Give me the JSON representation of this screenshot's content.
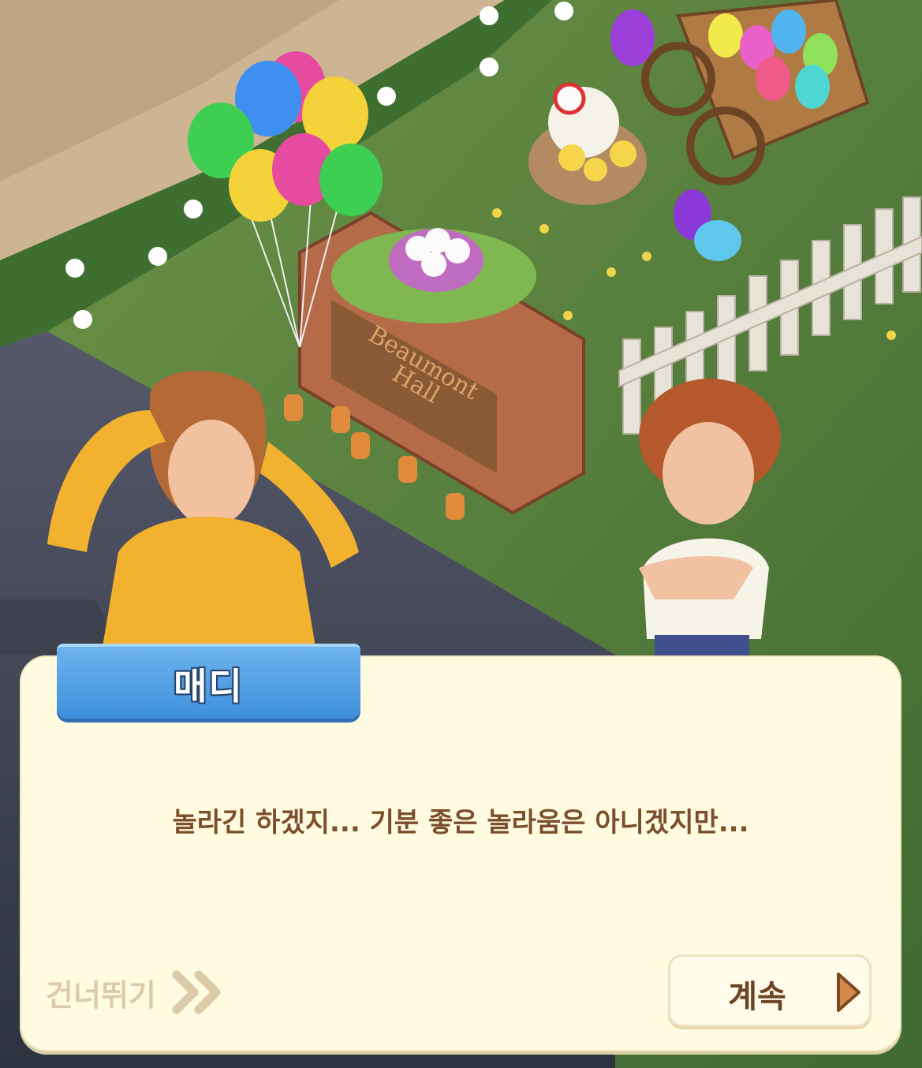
{
  "scene": {
    "icons": [
      "balloon-bunch-icon",
      "egg-cart-icon",
      "hen-nest-icon",
      "beaumont-hall-sign-icon",
      "picket-fence-icon"
    ],
    "sign_text": [
      "Beaumont",
      "Hall"
    ]
  },
  "dialog": {
    "speaker": "매디",
    "message": "놀라긴 하겠지... 기분 좋은 놀라움은 아니겠지만...",
    "skip_label": "건너뛰기",
    "continue_label": "계속"
  },
  "colors": {
    "dialog_bg": "#fffbe0",
    "name_tab": "#4a9be3",
    "message_text": "#7b4f2c",
    "skip_text": "#dccba9",
    "continue_arrow": "#d38a4a"
  }
}
